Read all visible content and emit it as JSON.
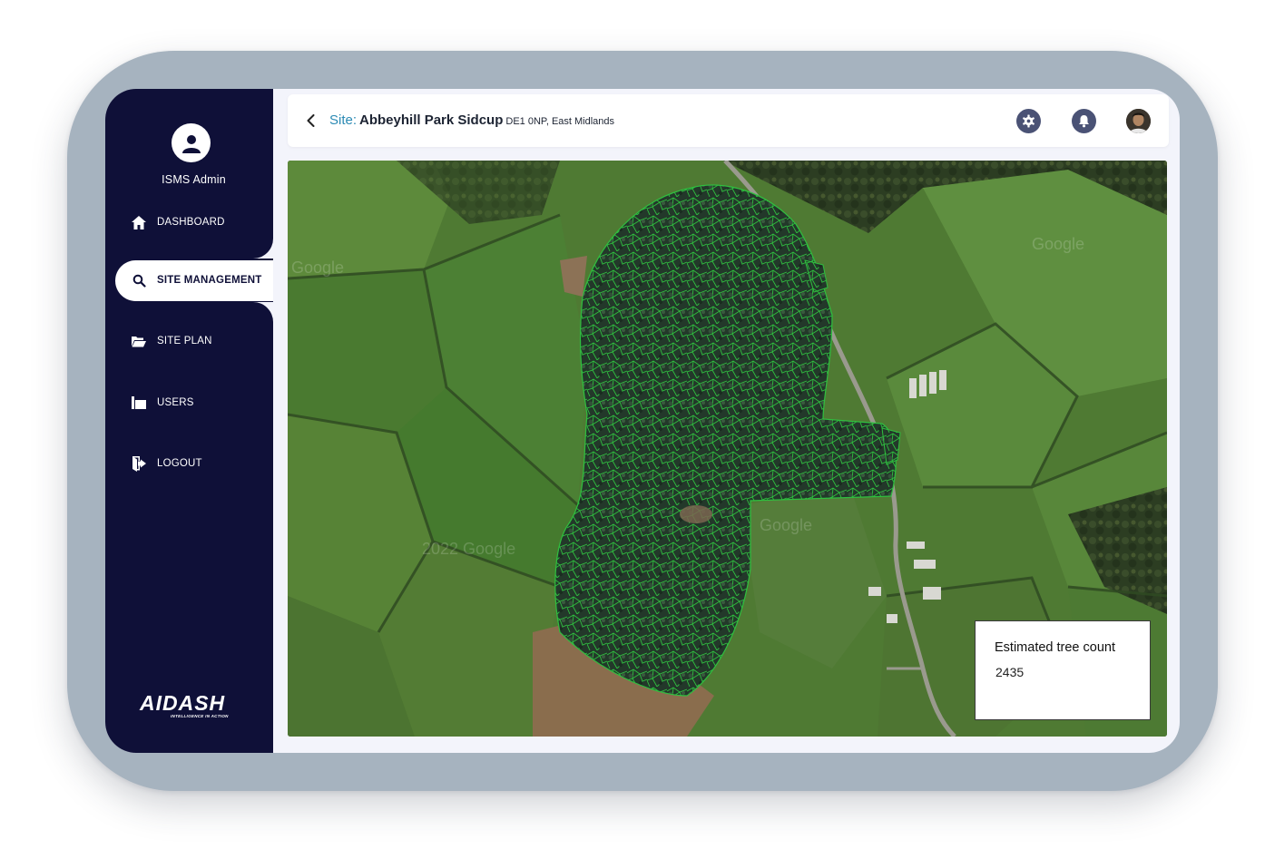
{
  "sidebar": {
    "admin_name": "ISMS Admin",
    "items": [
      {
        "label": "DASHBOARD",
        "icon": "home-icon"
      },
      {
        "label": "SITE MANAGEMENT",
        "icon": "search-icon",
        "active": true
      },
      {
        "label": "SITE PLAN",
        "icon": "folder-open-icon"
      },
      {
        "label": "USERS",
        "icon": "users-icon"
      },
      {
        "label": "LOGOUT",
        "icon": "logout-icon"
      }
    ],
    "logo": {
      "mark": "AIDASH",
      "tagline": "INTELLIGENCE IN ACTION"
    }
  },
  "header": {
    "site_label": "Site:",
    "site_name": "Abbeyhill Park Sidcup",
    "site_address": "DE1 0NP, East Midlands",
    "icons": [
      "back-icon",
      "gear-icon",
      "bell-icon",
      "user-avatar"
    ]
  },
  "map": {
    "watermarks": [
      "Google",
      "2022 Google",
      "Google",
      "Google"
    ]
  },
  "tree_count": {
    "label": "Estimated tree count",
    "value": "2435"
  },
  "colors": {
    "sidebar_bg": "#0f1038",
    "accent_blue": "#2b8ab4",
    "tree_outline": "#2fbf3f",
    "icon_button": "#4a5275"
  }
}
